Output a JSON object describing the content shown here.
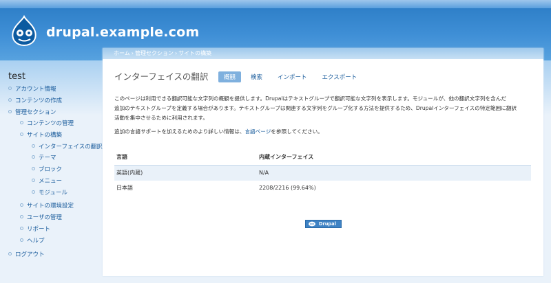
{
  "site": {
    "name": "drupal.example.com"
  },
  "breadcrumb": [
    "ホーム",
    "管理セクション",
    "サイトの構築"
  ],
  "sidebar": {
    "title": "test",
    "items": [
      {
        "label": "アカウント情報"
      },
      {
        "label": "コンテンツの作成"
      },
      {
        "label": "管理セクション"
      },
      {
        "label": "コンテンツの管理"
      },
      {
        "label": "サイトの構築"
      },
      {
        "label": "インターフェイスの翻訳"
      },
      {
        "label": "テーマ"
      },
      {
        "label": "ブロック"
      },
      {
        "label": "メニュー"
      },
      {
        "label": "モジュール"
      },
      {
        "label": "サイトの環境設定"
      },
      {
        "label": "ユーザの管理"
      },
      {
        "label": "リポート"
      },
      {
        "label": "ヘルプ"
      },
      {
        "label": "ログアウト"
      }
    ]
  },
  "page": {
    "title": "インターフェイスの翻訳",
    "tabs": [
      {
        "label": "概観",
        "active": true
      },
      {
        "label": "検索",
        "active": false
      },
      {
        "label": "インポート",
        "active": false
      },
      {
        "label": "エクスポート",
        "active": false
      }
    ],
    "description_lines": [
      "このページは利用できる翻訳可能な文字列の概観を提供します。Drupalはテキストグループで翻訳可能な文字列を表示します。モジュールが、他の翻訳文字列を含んだ",
      "追加のテキストグループを定義する場合があります。テキストグループは関連する文字列をグループ化する方法を提供するため、Drupalインターフェイスの特定範囲に翻訳",
      "活動を集中させるために利用されます。"
    ],
    "help": {
      "before": "追加の言語サポートを加えるためのより詳しい情報は、",
      "link": "言語ページ",
      "after": "を参照してください。"
    },
    "table": {
      "headers": [
        "言語",
        "内蔵インターフェイス"
      ],
      "rows": [
        [
          "英語(内蔵)",
          "N/A"
        ],
        [
          "日本語",
          "2208/2216 (99.64%)"
        ]
      ]
    },
    "powered_by": "Drupal"
  },
  "colors": {
    "header": "#3f8fd6",
    "link": "#1a5c9c",
    "active_tab": "#7fb0de"
  }
}
